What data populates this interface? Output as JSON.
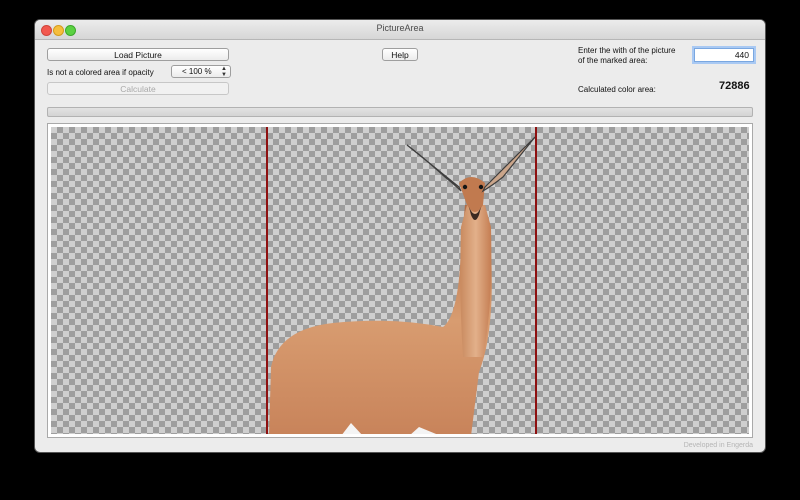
{
  "window": {
    "title": "PictureArea"
  },
  "controls": {
    "load_label": "Load Picture",
    "help_label": "Help",
    "opacity_label": "Is not a colored area if opacity",
    "opacity_value": "< 100 %",
    "calculate_label": "Calculate",
    "width_prompt_line1": "Enter the with of the picture",
    "width_prompt_line2": "of the marked area:",
    "width_value": "440",
    "result_label": "Calculated color area:",
    "result_value": "72886"
  },
  "footer": {
    "text": "Developed in Engerda"
  },
  "progress": {
    "fraction": 0
  },
  "colors": {
    "marker": "#8e1010",
    "focus": "#7aa7e0"
  },
  "icons": [
    "close-icon",
    "minimize-icon",
    "zoom-icon",
    "stepper-arrows-icon"
  ]
}
